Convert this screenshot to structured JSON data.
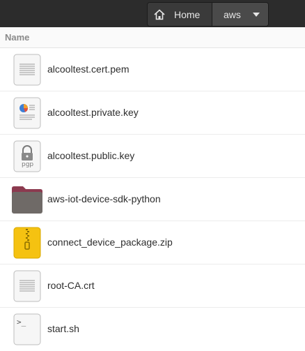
{
  "pathbar": {
    "home_label": "Home",
    "current_label": "aws"
  },
  "columns": {
    "name": "Name"
  },
  "files": [
    {
      "name": "alcooltest.cert.pem",
      "icon": "certificate-file-icon"
    },
    {
      "name": "alcooltest.private.key",
      "icon": "private-key-file-icon"
    },
    {
      "name": "alcooltest.public.key",
      "icon": "pgp-key-file-icon",
      "icon_text": "pgp"
    },
    {
      "name": "aws-iot-device-sdk-python",
      "icon": "folder-icon"
    },
    {
      "name": "connect_device_package.zip",
      "icon": "zip-archive-icon"
    },
    {
      "name": "root-CA.crt",
      "icon": "certificate-file-icon"
    },
    {
      "name": "start.sh",
      "icon": "shell-script-icon",
      "icon_text": ">_"
    }
  ],
  "colors": {
    "titlebar": "#2c2c2c",
    "folder": "#6f6a67",
    "folder_tab": "#8c3a4f",
    "zip": "#f5c211"
  }
}
